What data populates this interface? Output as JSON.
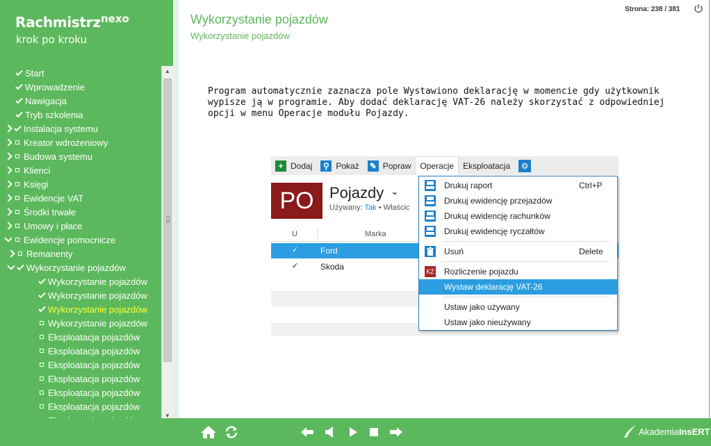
{
  "app": {
    "logo_main": "Rachmistrz",
    "logo_sup": "nexo",
    "logo_sub": "krok po kroku"
  },
  "header": {
    "title": "Wykorzystanie pojazdów",
    "subtitle": "Wykorzystanie pojazdów",
    "page_counter": "Strona: 238 / 381",
    "power_icon": "power-icon"
  },
  "body_text": "Program automatycznie zaznacza pole Wystawiono deklarację w momencie gdy użytkownik wypisze ją w programie. Aby dodać deklarację VAT-26 należy skorzystać z odpowiedniej opcji w menu Operacje modułu Pojazdy.",
  "tree": [
    {
      "label": "Start",
      "arrow": "",
      "mark": "check",
      "active": false
    },
    {
      "label": "Wprowadzenie",
      "arrow": "",
      "mark": "check",
      "active": false
    },
    {
      "label": "Nawigacja",
      "arrow": "",
      "mark": "check",
      "active": false
    },
    {
      "label": "Tryb szkolenia",
      "arrow": "",
      "mark": "check",
      "active": false
    },
    {
      "label": "Instalacja systemu",
      "arrow": "right",
      "mark": "check",
      "active": false
    },
    {
      "label": "Kreator wdrożeniowy",
      "arrow": "right",
      "mark": "square",
      "active": false
    },
    {
      "label": "Budowa systemu",
      "arrow": "right",
      "mark": "square",
      "active": false
    },
    {
      "label": "Klienci",
      "arrow": "right",
      "mark": "square",
      "active": false
    },
    {
      "label": "Księgi",
      "arrow": "right",
      "mark": "square",
      "active": false
    },
    {
      "label": "Ewidencje VAT",
      "arrow": "right",
      "mark": "square",
      "active": false
    },
    {
      "label": "Środki trwałe",
      "arrow": "right",
      "mark": "square",
      "active": false
    },
    {
      "label": "Umowy i płace",
      "arrow": "right",
      "mark": "square",
      "active": false
    },
    {
      "label": "Ewidencje pomocnicze",
      "arrow": "down",
      "mark": "square",
      "active": false
    },
    {
      "label": "Remanenty",
      "arrow": "right",
      "mark": "square",
      "active": false
    },
    {
      "label": "Wykorzystanie pojazdów",
      "arrow": "down",
      "mark": "check",
      "active": false
    },
    {
      "label": "Wykorzystanie pojazdów",
      "arrow": "",
      "mark": "check",
      "active": false
    },
    {
      "label": "Wykorzystanie pojazdów",
      "arrow": "",
      "mark": "check",
      "active": false
    },
    {
      "label": "Wykorzystanie pojazdów",
      "arrow": "",
      "mark": "check",
      "active": true
    },
    {
      "label": "Wykorzystanie pojazdów",
      "arrow": "",
      "mark": "square",
      "active": false
    },
    {
      "label": "Eksploatacja pojazdów",
      "arrow": "",
      "mark": "square",
      "active": false
    },
    {
      "label": "Eksploatacja pojazdów",
      "arrow": "",
      "mark": "square",
      "active": false
    },
    {
      "label": "Eksploatacja pojazdów",
      "arrow": "",
      "mark": "square",
      "active": false
    },
    {
      "label": "Eksploatacja pojazdów",
      "arrow": "",
      "mark": "square",
      "active": false
    },
    {
      "label": "Eksploatacja pojazdów",
      "arrow": "",
      "mark": "square",
      "active": false
    },
    {
      "label": "Eksploatacja pojazdów",
      "arrow": "",
      "mark": "square",
      "active": false
    },
    {
      "label": "Eksploatacja pojazdów",
      "arrow": "",
      "mark": "square",
      "active": false
    }
  ],
  "screenshot": {
    "toolbar": {
      "add": "Dodaj",
      "show": "Pokaż",
      "edit": "Popraw",
      "operations": "Operacje",
      "exploitation": "Eksploatacja"
    },
    "badge": "PO",
    "title": "Pojazdy",
    "filter_label": "Używany:",
    "filter_value": "Tak",
    "filter_extra": "Właścic",
    "columns": {
      "u": "U",
      "marka": "Marka"
    },
    "rows": [
      {
        "check": "✓",
        "name": "Ford",
        "selected": true
      },
      {
        "check": "✓",
        "name": "Skoda",
        "selected": false
      }
    ],
    "menu": [
      {
        "label": "Drukuj raport",
        "shortcut": "Ctrl+P",
        "icon": "print-icon"
      },
      {
        "label": "Drukuj ewidencję przejazdów",
        "shortcut": "",
        "icon": "print-icon"
      },
      {
        "label": "Drukuj ewidencję rachunków",
        "shortcut": "",
        "icon": "print-icon"
      },
      {
        "label": "Drukuj ewidencję ryczałtów",
        "shortcut": "",
        "icon": "print-icon"
      },
      {
        "label": "Usuń",
        "shortcut": "Delete",
        "icon": "trash-icon"
      },
      {
        "label": "Rozliczenie pojazdu",
        "shortcut": "",
        "icon": "kz-icon",
        "icon_text": "KZ"
      },
      {
        "label": "Wystaw deklarację VAT-26",
        "shortcut": "",
        "icon": "",
        "highlighted": true
      },
      {
        "label": "Ustaw jako używany",
        "shortcut": "",
        "icon": ""
      },
      {
        "label": "Ustaw jako nieużywany",
        "shortcut": "",
        "icon": ""
      }
    ]
  },
  "footer": {
    "brand_prefix": "Akademia",
    "brand_bold": "InsERT"
  },
  "colors": {
    "accent": "#5cb85c",
    "active_item": "#ffff33",
    "selection": "#2b9de0",
    "badge": "#8b1a1a"
  }
}
